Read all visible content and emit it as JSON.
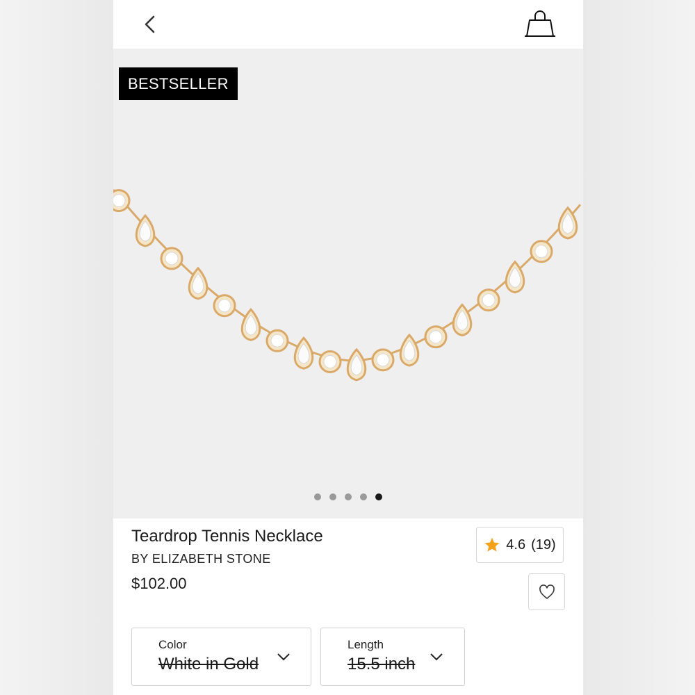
{
  "header": {
    "back_icon": "chevron-left-icon",
    "bag_icon": "shopping-bag-icon"
  },
  "gallery": {
    "badge": "BESTSELLER",
    "image": "teardrop-tennis-necklace-photo",
    "image_count": 5,
    "active_index": 4
  },
  "product": {
    "title": "Teardrop Tennis Necklace",
    "brand": "BY ELIZABETH STONE",
    "price": "$102.00",
    "rating": "4.6",
    "review_count": "(19)",
    "wishlist_icon": "heart-outline-icon"
  },
  "options": {
    "color": {
      "label": "Color",
      "value": "White in Gold",
      "unavailable": true
    },
    "length": {
      "label": "Length",
      "value": "15.5 inch",
      "unavailable": true
    }
  },
  "colors": {
    "badge_bg": "#000000",
    "star": "#f4a11a",
    "gold": "#d9a96a",
    "dot_active": "#1a1a1a",
    "dot_inactive": "#9a9a9a"
  }
}
